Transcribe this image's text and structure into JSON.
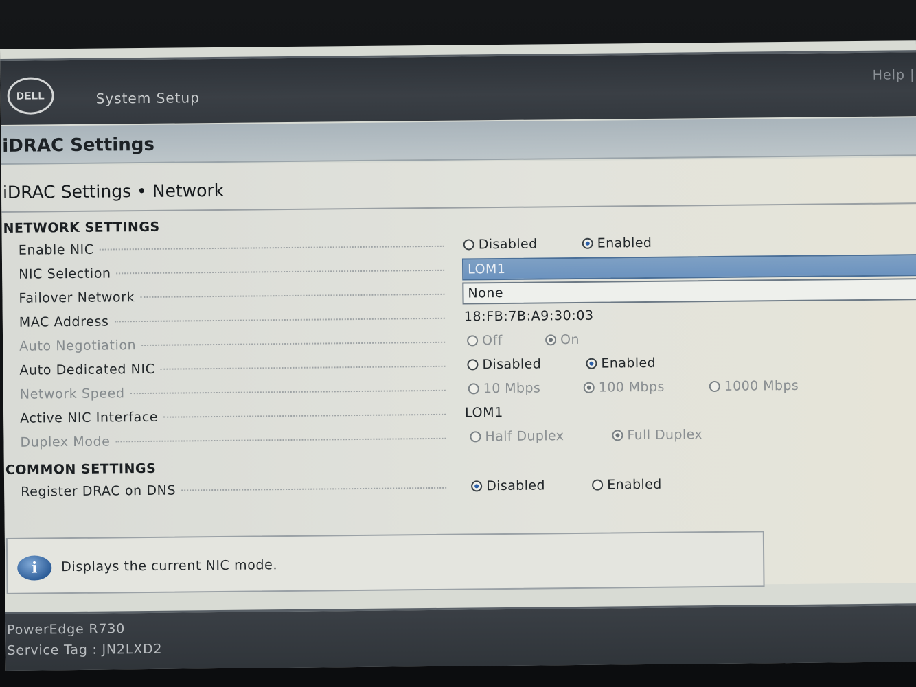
{
  "header": {
    "logo_text": "DELL",
    "title": "System Setup",
    "help": "Help |"
  },
  "page_title": "iDRAC Settings",
  "subtitle": "iDRAC Settings • Network",
  "network_settings": {
    "heading": "NETWORK SETTINGS",
    "enable_nic": {
      "label": "Enable NIC",
      "options": [
        "Disabled",
        "Enabled"
      ],
      "selected": "Enabled"
    },
    "nic_selection": {
      "label": "NIC Selection",
      "value": "LOM1"
    },
    "failover_network": {
      "label": "Failover Network",
      "value": "None"
    },
    "mac_address": {
      "label": "MAC Address",
      "value": "18:FB:7B:A9:30:03"
    },
    "auto_negotiation": {
      "label": "Auto Negotiation",
      "options": [
        "Off",
        "On"
      ],
      "selected": "On"
    },
    "auto_dedicated_nic": {
      "label": "Auto Dedicated NIC",
      "options": [
        "Disabled",
        "Enabled"
      ],
      "selected": "Enabled"
    },
    "network_speed": {
      "label": "Network Speed",
      "options": [
        "10 Mbps",
        "100 Mbps",
        "1000 Mbps"
      ],
      "selected": "100 Mbps"
    },
    "active_nic_interface": {
      "label": "Active NIC Interface",
      "value": "LOM1"
    },
    "duplex_mode": {
      "label": "Duplex Mode",
      "options": [
        "Half Duplex",
        "Full Duplex"
      ],
      "selected": "Full Duplex"
    }
  },
  "common_settings": {
    "heading": "COMMON SETTINGS",
    "register_drac_on_dns": {
      "label": "Register DRAC on DNS",
      "options": [
        "Disabled",
        "Enabled"
      ],
      "selected": "Disabled"
    }
  },
  "info": {
    "icon": "info-icon",
    "text": "Displays the current NIC mode."
  },
  "footer": {
    "model": "PowerEdge R730",
    "service_tag": "Service Tag : JN2LXD2"
  },
  "colors": {
    "header_bg": "#34393f",
    "band_bg": "#b3bdc2",
    "selection": "#7398c2",
    "radio_on": "#2b5fa8"
  }
}
